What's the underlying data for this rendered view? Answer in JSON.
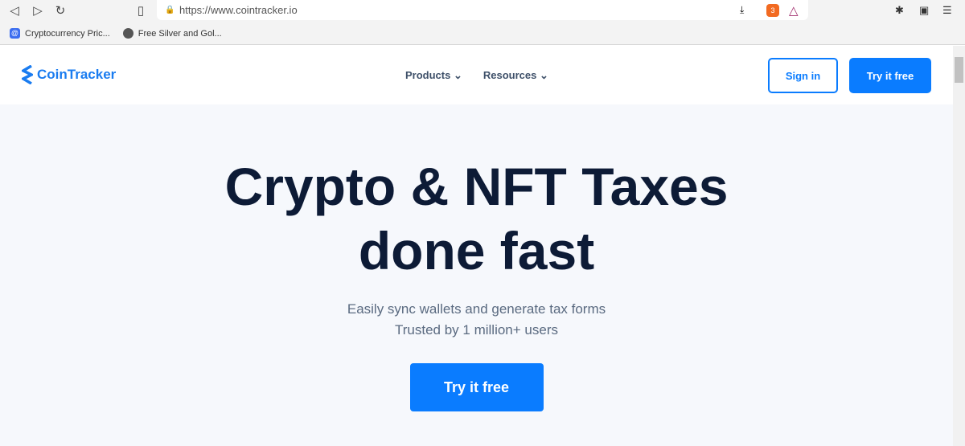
{
  "browser": {
    "url": "https://www.cointracker.io",
    "brave_badge": "3",
    "bookmarks": [
      {
        "label": "Cryptocurrency Pric..."
      },
      {
        "label": "Free Silver and Gol..."
      }
    ]
  },
  "header": {
    "logo": "CoinTracker",
    "menu": [
      {
        "label": "Products"
      },
      {
        "label": "Resources"
      }
    ],
    "sign_in": "Sign in",
    "try_free": "Try it free"
  },
  "hero": {
    "title_line1": "Crypto & NFT Taxes",
    "title_line2": "done fast",
    "subtitle_line1": "Easily sync wallets and generate tax forms",
    "subtitle_line2": "Trusted by 1 million+ users",
    "cta": "Try it free"
  },
  "colors": {
    "accent": "#0a7cff",
    "heading": "#0d1b36"
  }
}
